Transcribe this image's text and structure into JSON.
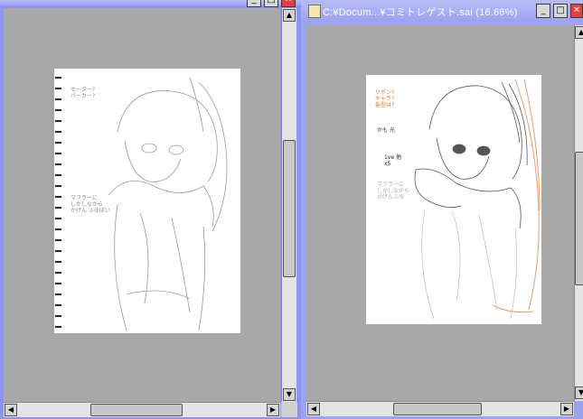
{
  "left_window": {
    "title": "",
    "buttons": {
      "minimize": "_",
      "maximize": "□",
      "close": "✕"
    }
  },
  "right_window": {
    "title": "C:¥Docum...¥コミトレゲスト.sai (16.66%)",
    "buttons": {
      "minimize": "_",
      "maximize": "□",
      "close": "✕"
    }
  },
  "left_sketch_notes": {
    "top": "セーター?\nパーカー?",
    "middle": "マフラーに\nしかしながら\nかげん ふゆぼい"
  },
  "right_sketch_notes": {
    "orange": "リボン?\nキャラ?\n髪型は?",
    "black1": "かも 光",
    "black2": "1ve 他\nx5",
    "gray": "マフラーに\nしかしながら\nかげんふゆ"
  },
  "scroll_icons": {
    "up": "▲",
    "down": "▼",
    "left": "◀",
    "right": "▶"
  }
}
